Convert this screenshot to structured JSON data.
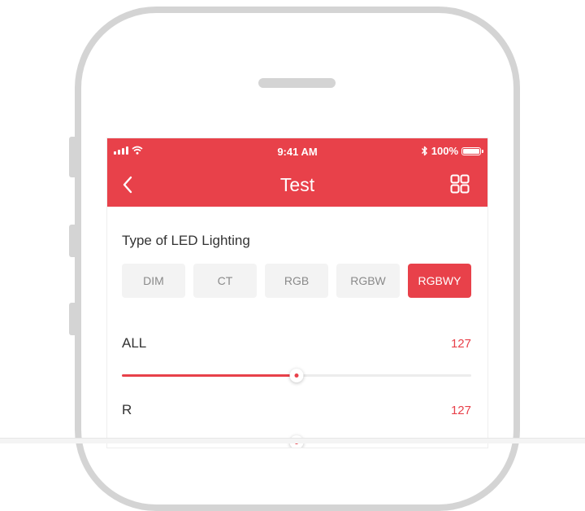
{
  "status": {
    "time": "9:41 AM",
    "battery": "100%"
  },
  "nav": {
    "title": "Test"
  },
  "led": {
    "section_title": "Type of LED Lighting",
    "types": [
      "DIM",
      "CT",
      "RGB",
      "RGBW",
      "RGBWY"
    ],
    "selected": "RGBWY"
  },
  "sliders": [
    {
      "label": "ALL",
      "value": "127",
      "fraction": 0.5
    },
    {
      "label": "R",
      "value": "127",
      "fraction": 0.5
    }
  ],
  "colors": {
    "accent": "#e8414a",
    "frame": "#d4d4d4"
  },
  "icons": {
    "back": "chevron-left-icon",
    "grid": "grid-icon",
    "wifi": "wifi-icon",
    "bluetooth": "bluetooth-icon"
  }
}
